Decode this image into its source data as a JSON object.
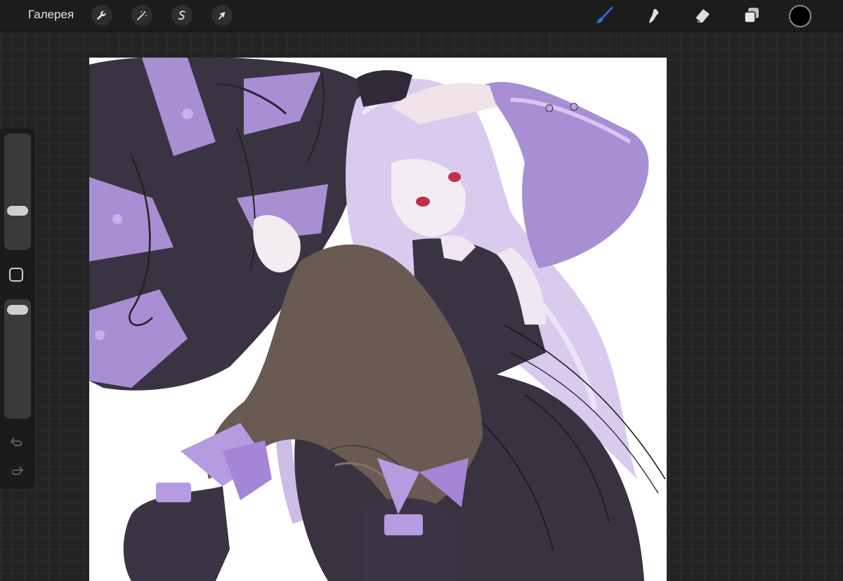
{
  "app": {
    "gallery_label": "Галерея"
  },
  "left_tools": [
    {
      "icon": "wrench-icon",
      "name": "actions"
    },
    {
      "icon": "magic-wand-icon",
      "name": "adjustments"
    },
    {
      "icon": "selection-s-icon",
      "name": "selection"
    },
    {
      "icon": "arrow-cursor-icon",
      "name": "transform"
    }
  ],
  "right_tools": [
    {
      "icon": "brush-icon",
      "name": "paint",
      "active": true
    },
    {
      "icon": "smudge-icon",
      "name": "smudge"
    },
    {
      "icon": "eraser-icon",
      "name": "erase"
    },
    {
      "icon": "layers-icon",
      "name": "layers"
    }
  ],
  "colors": {
    "active_tool": "#2f6fe6",
    "current_color": "#000000",
    "lavender": "#a58bcf",
    "dark_purple": "#3d3446"
  },
  "sidebar": {
    "brush_size": 0.2,
    "opacity": 1.0
  }
}
